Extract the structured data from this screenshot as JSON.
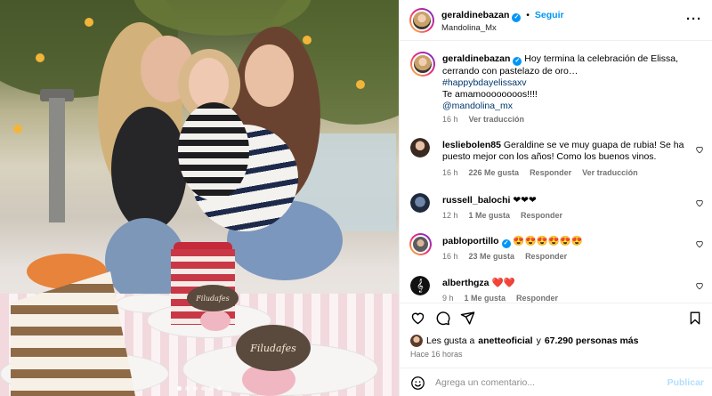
{
  "photo": {
    "tag_small": "Filudafes",
    "tag_large": "Filudafes",
    "carousel": {
      "count": 6,
      "active_index": 0
    }
  },
  "header": {
    "username": "geraldinebazan",
    "follow_label": "Seguir",
    "location": "Mandolina_Mx",
    "more_icon": "more-horizontal-icon"
  },
  "caption": {
    "username": "geraldinebazan",
    "text": "Hoy termina la celebración de Elissa, cerrando con pastelazo de oro…",
    "hashtag": "#happybdayelissaxv",
    "line2": "Te amamoooooooos!!!!",
    "mention": "@mandolina_mx",
    "time": "16 h",
    "translate": "Ver traducción"
  },
  "comments": [
    {
      "username": "lesliebolen85",
      "verified": false,
      "text": "Geraldine se ve muy guapa de rubia! Se ha puesto mejor con los años! Como los buenos vinos.",
      "time": "16 h",
      "likes": "226 Me gusta",
      "reply": "Responder",
      "translate": "Ver traducción"
    },
    {
      "username": "russell_balochi",
      "verified": false,
      "text": "❤❤❤",
      "time": "12 h",
      "likes": "1 Me gusta",
      "reply": "Responder"
    },
    {
      "username": "pabloportillo",
      "verified": true,
      "text": "😍😍😍😍😍😍",
      "time": "16 h",
      "likes": "23 Me gusta",
      "reply": "Responder"
    },
    {
      "username": "alberthgza",
      "verified": false,
      "text": "❤️❤️",
      "time": "9 h",
      "likes": "1 Me gusta",
      "reply": "Responder"
    }
  ],
  "likes": {
    "prefix": "Les gusta a",
    "user": "anetteoficial",
    "conj": "y",
    "count": "67.290 personas más"
  },
  "timeago": "Hace 16 horas",
  "add_comment": {
    "placeholder": "Agrega un comentario...",
    "publish_label": "Publicar"
  },
  "colors": {
    "accent": "#0095f6",
    "muted": "#737373",
    "publish_disabled": "#b2dffc"
  }
}
